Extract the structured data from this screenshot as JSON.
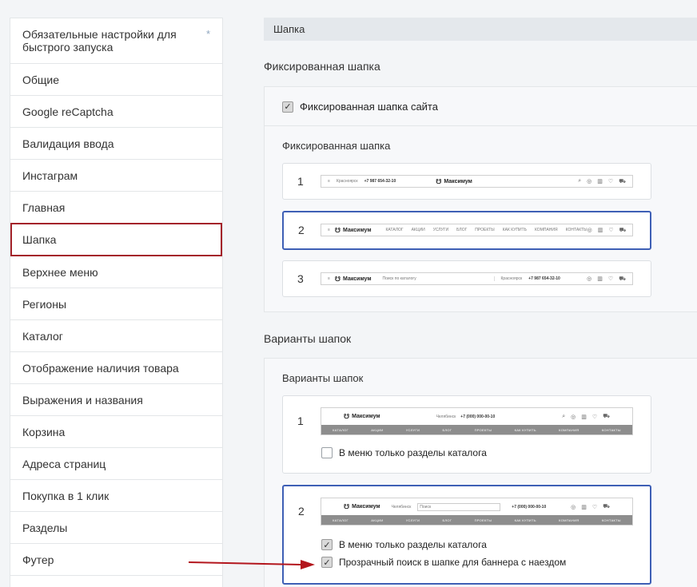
{
  "sidebar": {
    "items": [
      {
        "label": "Обязательные настройки для быстрого запуска"
      },
      {
        "label": "Общие"
      },
      {
        "label": "Google reCaptcha"
      },
      {
        "label": "Валидация ввода"
      },
      {
        "label": "Инстаграм"
      },
      {
        "label": "Главная"
      },
      {
        "label": "Шапка"
      },
      {
        "label": "Верхнее меню"
      },
      {
        "label": "Регионы"
      },
      {
        "label": "Каталог"
      },
      {
        "label": "Отображение наличия товара"
      },
      {
        "label": "Выражения и названия"
      },
      {
        "label": "Корзина"
      },
      {
        "label": "Адреса страниц"
      },
      {
        "label": "Покупка в 1 клик"
      },
      {
        "label": "Разделы"
      },
      {
        "label": "Футер"
      }
    ],
    "star": "*"
  },
  "section": {
    "header": "Шапка",
    "fixed_group_title": "Фиксированная шапка",
    "fixed_checkbox_label": "Фиксированная шапка сайта",
    "fixed_sub_title": "Фиксированная шапка",
    "fixed_options": [
      {
        "num": "1",
        "phone": "+7 987 654-32-10",
        "city": "Красноярск",
        "logo": "Максимум"
      },
      {
        "num": "2",
        "logo": "Максимум",
        "menu": [
          "КАТАЛОГ",
          "АКЦИИ",
          "УСЛУГИ",
          "БЛОГ",
          "ПРОЕКТЫ",
          "КАК КУПИТЬ",
          "КОМПАНИЯ",
          "КОНТАКТЫ"
        ]
      },
      {
        "num": "3",
        "logo": "Максимум",
        "search": "Поиск по каталогу",
        "city": "Красноярск",
        "phone": "+7 987 654-32-10"
      }
    ],
    "variants_group_title": "Варианты шапок",
    "variants_sub_title": "Варианты шапок",
    "variants": [
      {
        "num": "1",
        "logo": "Максимум",
        "phone": "+7 (000) 000-00-10",
        "city": "Челябинск",
        "menu": [
          "КАТАЛОГ",
          "АКЦИИ",
          "УСЛУГИ",
          "БЛОГ",
          "ПРОЕКТЫ",
          "КАК КУПИТЬ",
          "КОМПАНИЯ",
          "КОНТАКТЫ"
        ],
        "option1": "В меню только разделы каталога"
      },
      {
        "num": "2",
        "logo": "Максимум",
        "phone": "+7 (000) 000-00-10",
        "city": "Челябинск",
        "search": "Поиск",
        "menu": [
          "КАТАЛОГ",
          "АКЦИИ",
          "УСЛУГИ",
          "БЛОГ",
          "ПРОЕКТЫ",
          "КАК КУПИТЬ",
          "КОМПАНИЯ",
          "КОНТАКТЫ"
        ],
        "option1": "В меню только разделы каталога",
        "option2": "Прозрачный поиск в шапке для баннера с наездом"
      }
    ]
  },
  "colors": {
    "active_outline": "#a4232a",
    "selected_border": "#3e5fb5",
    "arrow": "#b3161d"
  }
}
